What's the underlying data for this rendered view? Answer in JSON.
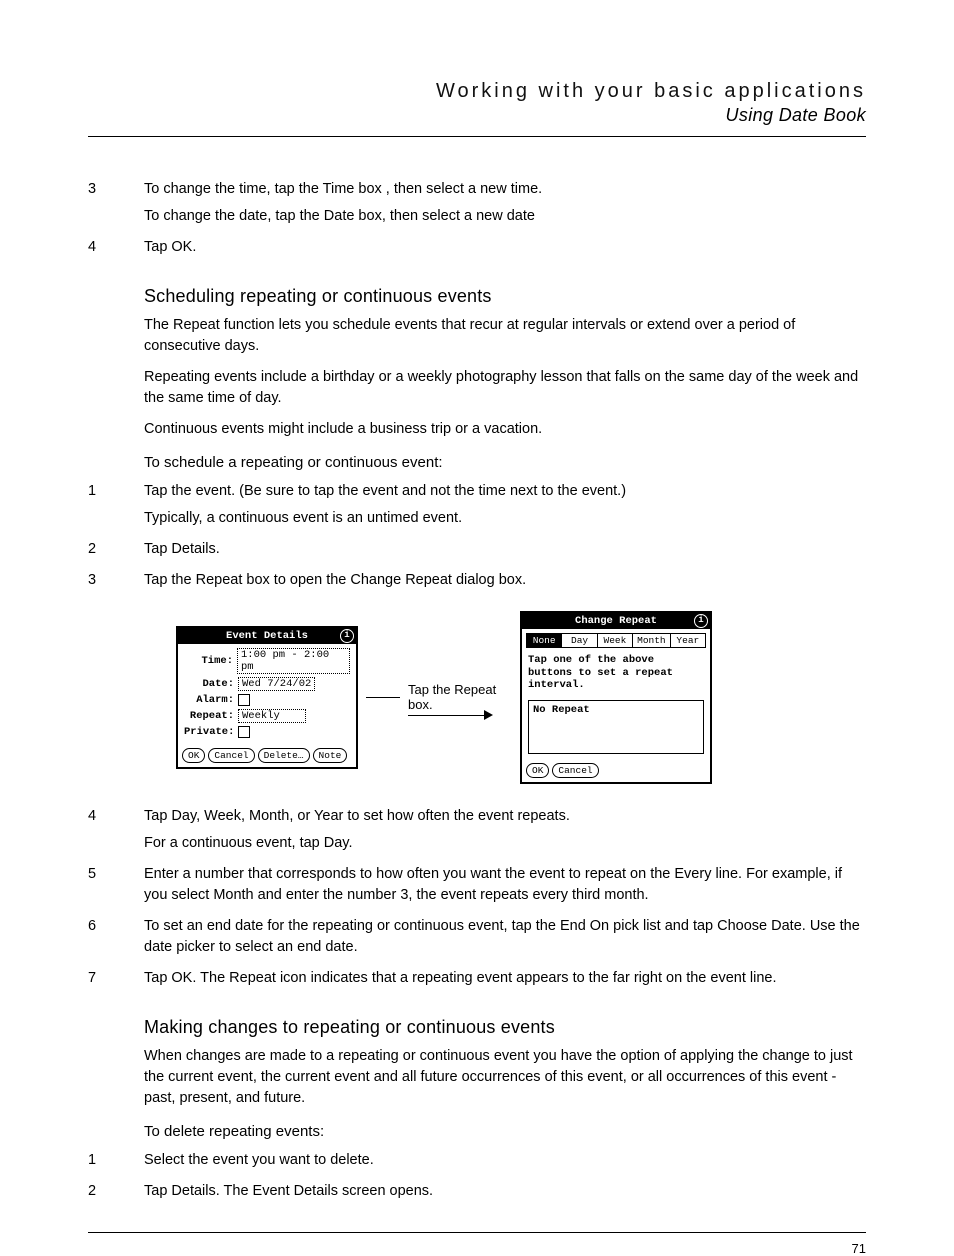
{
  "header": {
    "chapter": "Working with your basic applications",
    "section": "Using Date Book"
  },
  "top_steps": [
    {
      "num": "3",
      "lines": [
        "To change the time, tap the Time box , then select a new time.",
        "To change the date, tap the Date box, then select a new date"
      ]
    },
    {
      "num": "4",
      "lines": [
        "Tap OK."
      ]
    }
  ],
  "sched_heading": "Scheduling repeating or continuous events",
  "sched_paras": [
    "The Repeat function lets you schedule events that recur at regular intervals or extend over a period of consecutive days.",
    "Repeating events include a birthday or a weekly photography lesson that falls on the same day of the week and the same time of day.",
    "Continuous events might include a business trip or a vacation."
  ],
  "procedure1_title": "To schedule a repeating or continuous event:",
  "procedure1_steps": [
    {
      "num": "1",
      "lines": [
        "Tap the event. (Be sure to tap the event and not the time next to the event.)",
        "Typically, a continuous event is an untimed event."
      ]
    },
    {
      "num": "2",
      "lines": [
        "Tap Details."
      ]
    },
    {
      "num": "3",
      "lines": [
        "Tap the Repeat box to open the Change Repeat dialog box."
      ]
    }
  ],
  "event_details": {
    "title": "Event Details",
    "time_label": "Time:",
    "time_value": "1:00 pm - 2:00 pm",
    "date_label": "Date:",
    "date_value": "Wed 7/24/02",
    "alarm_label": "Alarm:",
    "repeat_label": "Repeat:",
    "repeat_value": "Weekly",
    "private_label": "Private:",
    "buttons": {
      "ok": "OK",
      "cancel": "Cancel",
      "delete": "Delete…",
      "note": "Note"
    }
  },
  "callout_text": "Tap the Repeat box.",
  "change_repeat": {
    "title": "Change Repeat",
    "tabs": [
      "None",
      "Day",
      "Week",
      "Month",
      "Year"
    ],
    "message": "Tap one of the above buttons to set a repeat interval.",
    "status": "No Repeat",
    "buttons": {
      "ok": "OK",
      "cancel": "Cancel"
    }
  },
  "after_figure_steps": [
    {
      "num": "4",
      "lines": [
        "Tap Day, Week, Month, or Year to set how often the event repeats.",
        "For a continuous event, tap Day."
      ]
    },
    {
      "num": "5",
      "lines": [
        "Enter a number that corresponds to how often you want the event to repeat on the Every line. For example, if you select Month and enter the number 3, the event repeats every third month."
      ]
    },
    {
      "num": "6",
      "lines": [
        "To set an end date for the repeating or continuous event, tap the End On pick list and tap Choose Date. Use the date picker to select an end date."
      ]
    },
    {
      "num": "7",
      "lines": [
        "Tap OK. The Repeat icon indicates that a repeating event appears to the far right on the event line."
      ]
    }
  ],
  "changes_heading": "Making changes to repeating or continuous events",
  "changes_para": "When changes are made to a repeating or continuous event you have the option of applying the change to just the current event, the current event and all future occurrences of this event, or all occurrences of this event - past, present, and future.",
  "procedure2_title": "To delete repeating events:",
  "procedure2_steps": [
    {
      "num": "1",
      "lines": [
        "Select the event you want to delete."
      ]
    },
    {
      "num": "2",
      "lines": [
        "Tap Details. The Event Details screen opens."
      ]
    }
  ],
  "page_number": "71"
}
